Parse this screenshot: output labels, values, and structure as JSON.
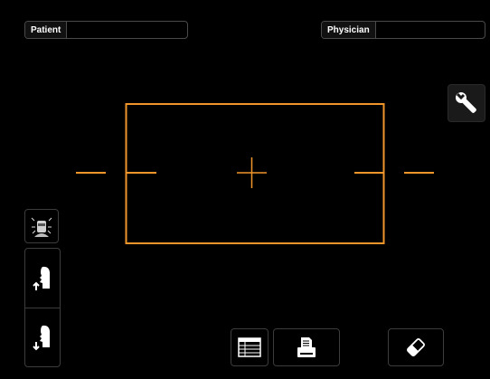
{
  "patient": {
    "label": "Patient",
    "value": ""
  },
  "physician": {
    "label": "Physician",
    "value": ""
  },
  "colors": {
    "accent": "#f0952a",
    "background": "#000000",
    "border": "#3c3c3c"
  },
  "icons": {
    "wrench": "wrench-icon",
    "face_scan": "face-scan-icon",
    "profile_up": "profile-up-icon",
    "profile_down": "profile-down-icon",
    "table": "table-icon",
    "print": "print-icon",
    "erase": "eraser-icon"
  }
}
